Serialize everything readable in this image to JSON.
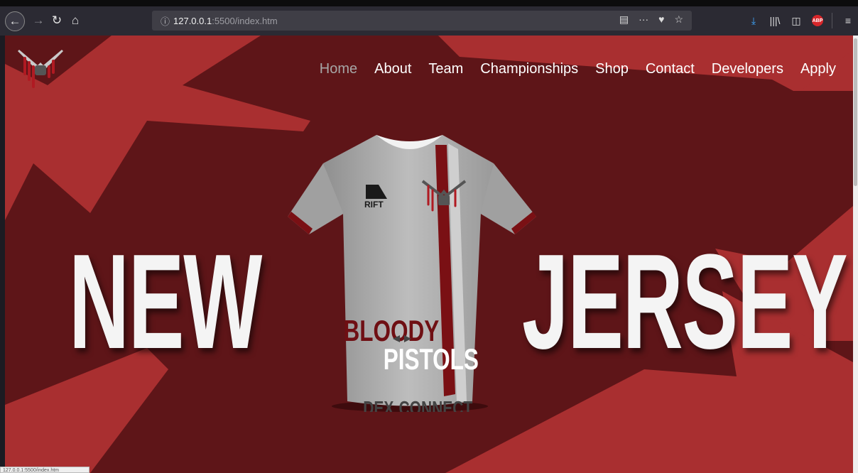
{
  "browser": {
    "url_host": "127.0.0.1",
    "url_path": ":5500/index.htm",
    "status_text": "127.0.0.1:5500/index.htm"
  },
  "nav": {
    "items": [
      "Home",
      "About",
      "Team",
      "Championships",
      "Shop",
      "Contact",
      "Developers",
      "Apply"
    ],
    "active": "Home"
  },
  "hero": {
    "left_word": "NEW",
    "right_word": "JERSEY"
  },
  "jersey": {
    "brand": "RIFT",
    "team_line1": "BLOODY",
    "team_line2": "PISTOLS",
    "sponsor_left": "DEX",
    "sponsor_right": "CONNECT"
  },
  "colors": {
    "background": "#5e1518",
    "accent": "#a92f30",
    "text": "#f4f4f4",
    "nav_active": "#a6a6a6"
  }
}
